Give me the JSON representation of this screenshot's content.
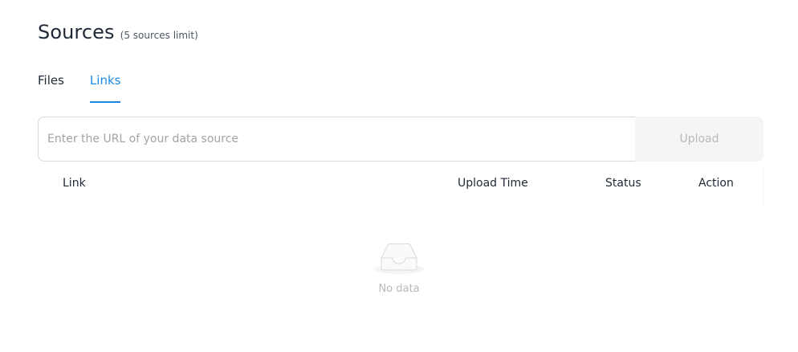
{
  "header": {
    "title": "Sources",
    "subtitle": "(5 sources limit)"
  },
  "tabs": [
    {
      "label": "Files",
      "active": false
    },
    {
      "label": "Links",
      "active": true
    }
  ],
  "url_input": {
    "placeholder": "Enter the URL of your data source",
    "value": ""
  },
  "upload_button": {
    "label": "Upload",
    "disabled": true
  },
  "table": {
    "columns": [
      "Link",
      "Upload Time",
      "Status",
      "Action"
    ],
    "rows": []
  },
  "empty_state": {
    "icon": "empty-inbox-icon",
    "text": "No data"
  },
  "colors": {
    "accent": "#1a88e6",
    "disabled_bg": "#f5f5f5",
    "muted_text": "#b8b8b8"
  }
}
